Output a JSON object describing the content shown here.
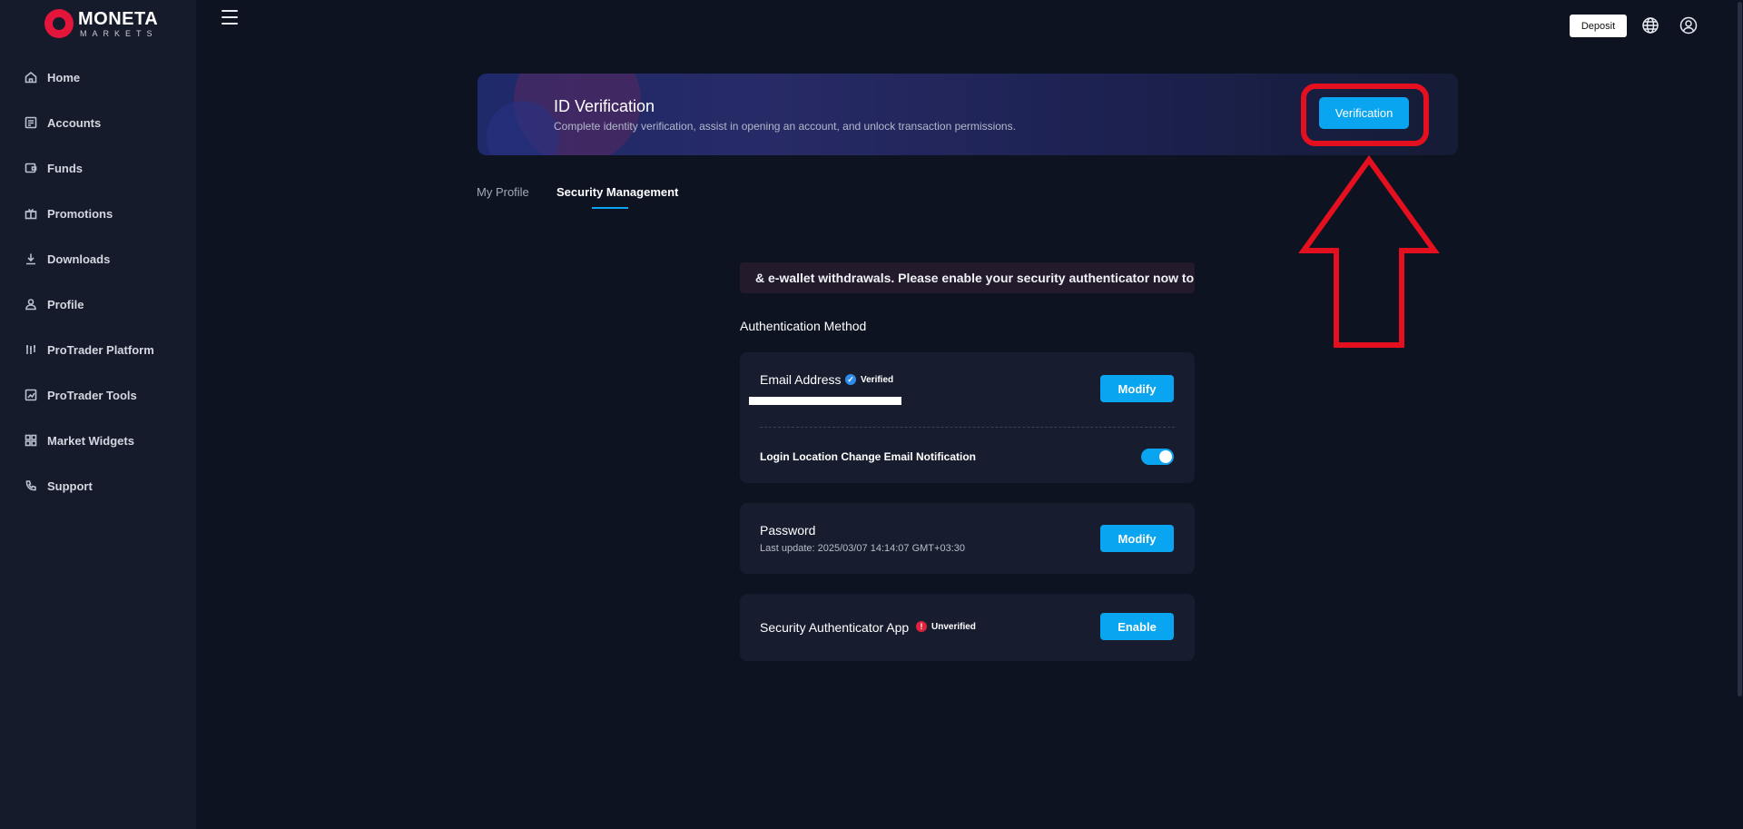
{
  "brand": {
    "name": "MONETA",
    "sub": "MARKETS",
    "color": "#e4153b"
  },
  "sidebar": {
    "items": [
      {
        "label": "Home",
        "icon": "home-icon"
      },
      {
        "label": "Accounts",
        "icon": "accounts-icon"
      },
      {
        "label": "Funds",
        "icon": "wallet-icon"
      },
      {
        "label": "Promotions",
        "icon": "gift-icon"
      },
      {
        "label": "Downloads",
        "icon": "download-icon"
      },
      {
        "label": "Profile",
        "icon": "user-icon"
      },
      {
        "label": "ProTrader Platform",
        "icon": "chart-candles-icon"
      },
      {
        "label": "ProTrader Tools",
        "icon": "tools-chart-icon"
      },
      {
        "label": "Market Widgets",
        "icon": "grid-icon"
      },
      {
        "label": "Support",
        "icon": "phone-icon"
      }
    ]
  },
  "topbar": {
    "deposit_label": "Deposit",
    "icons": [
      "menu-icon",
      "globe-icon",
      "user-circle-icon"
    ]
  },
  "banner": {
    "title": "ID Verification",
    "description": "Complete identity verification, assist in opening an account, and unlock transaction permissions.",
    "button_label": "Verification"
  },
  "tabs": [
    {
      "label": "My Profile",
      "active": false
    },
    {
      "label": "Security Management",
      "active": true
    }
  ],
  "notice": "& e-wallet withdrawals. Please enable your security authenticator now to secur",
  "section_title": "Authentication Method",
  "email_card": {
    "title": "Email Address",
    "status": "Verified",
    "button_label": "Modify",
    "notification_label": "Login Location Change Email Notification",
    "notification_enabled": true
  },
  "password_card": {
    "title": "Password",
    "last_update": "Last update: 2025/03/07 14:14:07 GMT+03:30",
    "button_label": "Modify"
  },
  "auth_card": {
    "title": "Security Authenticator App",
    "status": "Unverified",
    "button_label": "Enable"
  },
  "colors": {
    "accent": "#0aa5f0",
    "background": "#0e1322",
    "sidebar": "#151b2b",
    "annotation": "#e4101f"
  }
}
